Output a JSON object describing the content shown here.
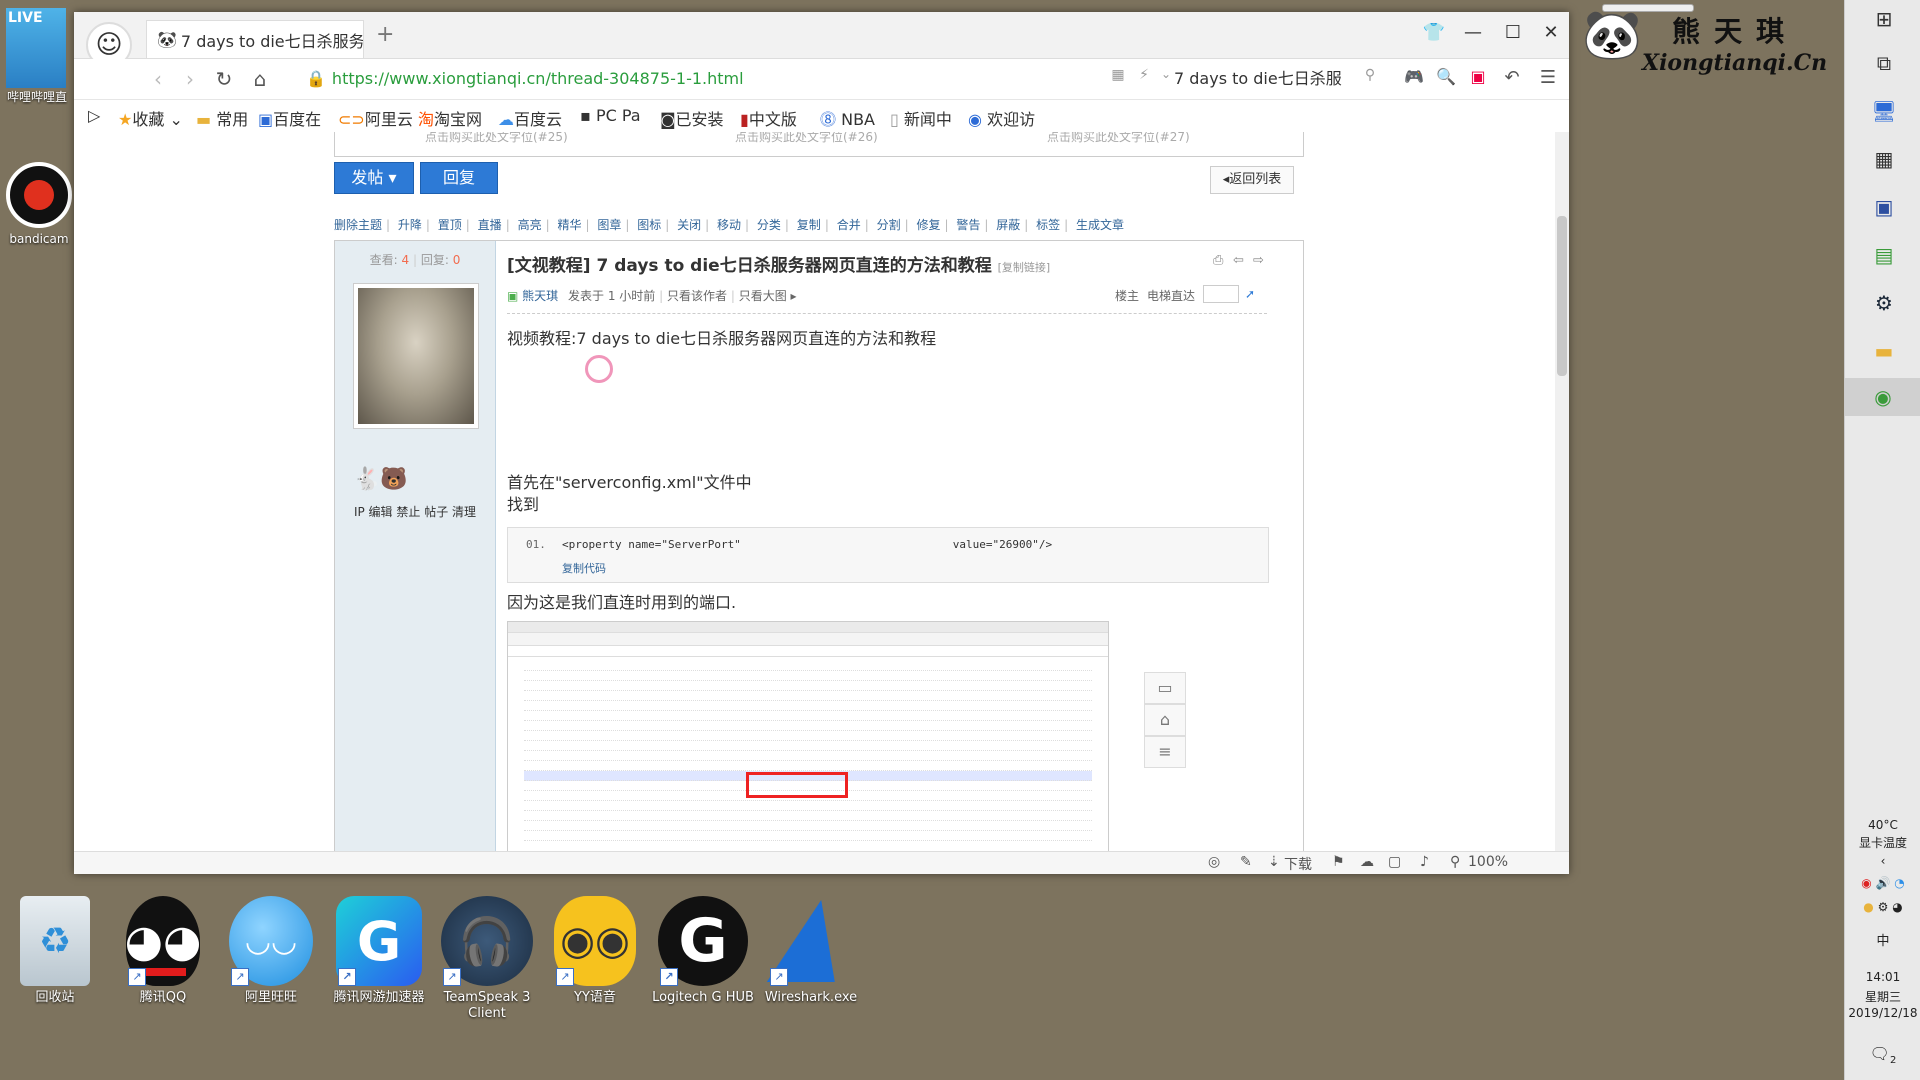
{
  "browser": {
    "tab_title": "7 days to die七日杀服务",
    "url": "https://www.xiongtianqi.cn/thread-304875-1-1.html",
    "search_text": "7 days to die七日杀服",
    "bookmarks": [
      "收藏",
      "常用",
      "百度在",
      "阿里云",
      "淘宝网",
      "百度云",
      "PC Pa",
      "已安装",
      "中文版",
      "NBA",
      "新闻中",
      "欢迎访"
    ],
    "status_download": "下载",
    "status_zoom": "100%"
  },
  "page": {
    "top_tabs": [
      "点击购买此处文字位(#25)",
      "点击购买此处文字位(#26)",
      "点击购买此处文字位(#27)"
    ],
    "post_button": "发帖",
    "reply_button": "回复",
    "back_button": "返回列表",
    "mod_actions": [
      "删除主题",
      "升降",
      "置顶",
      "直播",
      "高亮",
      "精华",
      "图章",
      "图标",
      "关闭",
      "移动",
      "分类",
      "复制",
      "合并",
      "分割",
      "修复",
      "警告",
      "屏蔽",
      "标签",
      "生成文章"
    ],
    "stats_label_view": "查看:",
    "stats_view": "4",
    "stats_label_reply": "回复:",
    "stats_reply": "0",
    "user_links": "IP 编辑 禁止 帖子 清理",
    "title": "[文视教程] 7 days to die七日杀服务器网页直连的方法和教程",
    "copy_link": "[复制链接]",
    "author": "熊天琪",
    "posted": "发表于 1 小时前",
    "only_author": "只看该作者",
    "only_big": "只看大图",
    "floor": "楼主",
    "elevator": "电梯直达",
    "line1": "视频教程:7 days to die七日杀服务器网页直连的方法和教程",
    "line2": "首先在\"serverconfig.xml\"文件中",
    "line3": "找到",
    "code_num": "01.",
    "code_text": "<property name=\"ServerPort\"                                value=\"26900\"/>",
    "copy_code": "复制代码",
    "line4": "因为这是我们直连时用到的端口."
  },
  "desktop": {
    "icons": [
      "回收站",
      "腾讯QQ",
      "阿里旺旺",
      "腾讯网游加速器",
      "TeamSpeak 3 Client",
      "YY语音",
      "Logitech G HUB",
      "Wireshark.exe"
    ],
    "left_top": "哔哩哔哩直",
    "left_mid": "bandicam",
    "logo_cn": "熊天琪",
    "logo_en": "Xiongtianqi.Cn"
  },
  "taskbar": {
    "temp": "40°C",
    "temp_label": "显卡温度",
    "ime": "中",
    "time": "14:01",
    "weekday": "星期三",
    "date": "2019/12/18",
    "notif": "2"
  }
}
